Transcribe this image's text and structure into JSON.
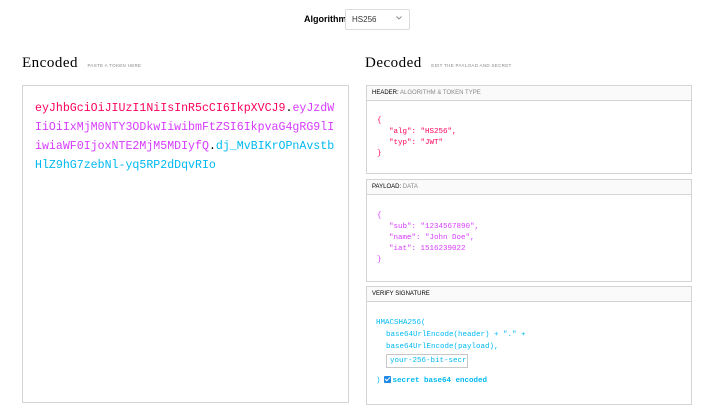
{
  "algorithm": {
    "label": "Algorithm",
    "selected": "HS256"
  },
  "encoded": {
    "title": "Encoded",
    "subtitle": "PASTE A TOKEN HERE",
    "header_part": "eyJhbGciOiJIUzI1NiIsInR5cCI6IkpXVCJ9",
    "payload_part": "eyJzdWIiOiIxMjM0NTY3ODkwIiwibmFtZSI6IkpvaG4gRG9lIiwiaWF0IjoxNTE2MjM5MDIyfQ",
    "signature_part": "dj_MvBIKrOPnAvstbHlZ9hG7zebNl-yq5RP2dDqvRIo",
    "dot": "."
  },
  "decoded": {
    "title": "Decoded",
    "subtitle": "EDIT THE PAYLOAD AND SECRET",
    "header_panel": {
      "label": "HEADER:",
      "sublabel": "ALGORITHM & TOKEN TYPE",
      "open": "{",
      "close": "}",
      "line1": "\"alg\": \"HS256\",",
      "line2": "\"typ\": \"JWT\""
    },
    "payload_panel": {
      "label": "PAYLOAD:",
      "sublabel": "DATA",
      "open": "{",
      "close": "}",
      "line1": "\"sub\": \"1234567890\",",
      "line2": "\"name\": \"John Doe\",",
      "line3": "\"iat\": 1516239022"
    },
    "signature_panel": {
      "label": "VERIFY SIGNATURE",
      "fn": "HMACSHA256(",
      "line1": "base64UrlEncode(header) + \".\" +",
      "line2": "base64UrlEncode(payload),",
      "secret_value": "your-256-bit-secret",
      "close": ")",
      "checkbox_label": "secret base64 encoded",
      "checkbox_checked": true
    }
  },
  "colors": {
    "header": "#fb015b",
    "payload": "#d63aff",
    "signature": "#00b9f1"
  }
}
